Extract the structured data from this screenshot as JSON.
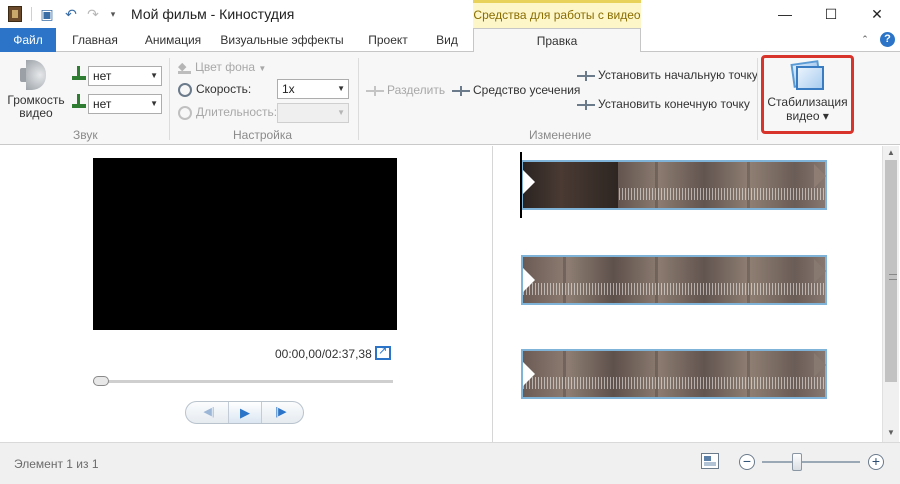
{
  "window": {
    "title": "Мой фильм - Киностудия",
    "context_tab_group": "Средства для работы с видео",
    "controls": {
      "minimize": "—",
      "maximize": "☐",
      "close": "✕"
    }
  },
  "quick_access": {
    "save_icon": "save-icon",
    "undo_icon": "undo-icon",
    "redo_icon": "redo-icon",
    "customize_glyph": "▾"
  },
  "tabs": {
    "file": "Файл",
    "home": "Главная",
    "animation": "Анимация",
    "visual_effects": "Визуальные эффекты",
    "project": "Проект",
    "view": "Вид",
    "edit": "Правка",
    "active": "Правка",
    "help_glyph": "?",
    "collapse_glyph": "⌃"
  },
  "ribbon": {
    "sound": {
      "group_label": "Звук",
      "volume_label": "Громкость видео",
      "fade_in_value": "нет",
      "fade_out_value": "нет"
    },
    "adjust": {
      "group_label": "Настройка",
      "background_color_label": "Цвет фона",
      "speed_label": "Скорость:",
      "speed_value": "1x",
      "duration_label": "Длительность:",
      "duration_value": ""
    },
    "edit": {
      "group_label": "Изменение",
      "split_label": "Разделить",
      "trim_tool_label": "Средство усечения",
      "set_start_label": "Установить начальную точку",
      "set_end_label": "Установить конечную точку"
    },
    "stabilization": {
      "label_line1": "Стабилизация",
      "label_line2": "видео ▾",
      "highlight_color": "#d9342b"
    }
  },
  "preview": {
    "timecode": "00:00,00/02:37,38",
    "seek_position": 0.0,
    "prev_frame_glyph": "◀|",
    "play_glyph": "▶",
    "next_frame_glyph": "|▶"
  },
  "storyboard": {
    "clips": [
      {
        "name": "clip-1",
        "selected": true
      },
      {
        "name": "clip-2",
        "selected": false
      },
      {
        "name": "clip-3",
        "selected": false
      }
    ],
    "scroll_up_glyph": "▲",
    "scroll_down_glyph": "▼"
  },
  "status": {
    "text": "Элемент 1 из 1",
    "zoom_out_glyph": "−",
    "zoom_in_glyph": "+"
  },
  "colors": {
    "accent": "#2b74c7",
    "context_tab_bg": "#fcf6c9",
    "clip_border": "#7fb3d8"
  }
}
